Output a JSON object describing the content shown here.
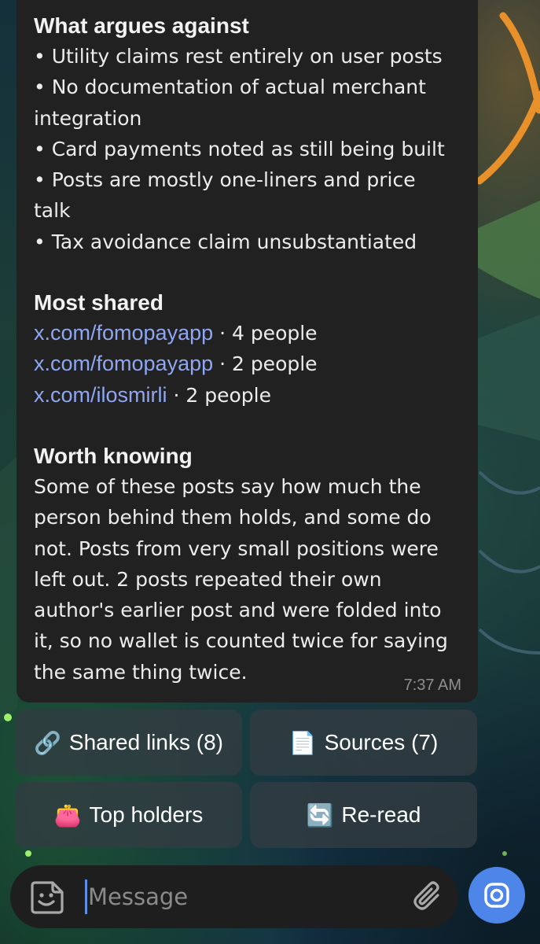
{
  "message": {
    "against": {
      "title": "What argues against",
      "lines": [
        "• Utility claims rest entirely on user posts",
        "• No documentation of actual merchant",
        "integration",
        "• Card payments noted as still being built",
        "• Posts are mostly one-liners and price",
        "talk",
        "• Tax avoidance claim unsubstantiated"
      ]
    },
    "most_shared": {
      "title": "Most shared",
      "links": [
        {
          "url": "x.com/fomopayapp",
          "count": " · 4 people"
        },
        {
          "url": "x.com/fomopayapp",
          "count": " · 2 people"
        },
        {
          "url": "x.com/ilosmirli",
          "count": " · 2 people"
        }
      ]
    },
    "worth_knowing": {
      "title": "Worth knowing",
      "lines": [
        "Some of these posts say how much the",
        "person behind them holds, and some do",
        "not. Posts from very small positions were",
        "left out. 2 posts repeated their own",
        "author's earlier post and were folded into",
        "it, so no wallet is counted twice for saying",
        "the same thing twice."
      ]
    },
    "time": "7:37 AM"
  },
  "keyboard": {
    "shared_links": {
      "icon": "🔗",
      "label": "Shared links (8)"
    },
    "sources": {
      "icon": "📄",
      "label": "Sources (7)"
    },
    "top_holders": {
      "icon": "👛",
      "label": "Top holders"
    },
    "reread": {
      "icon": "🔄",
      "label": "Re-read"
    }
  },
  "composer": {
    "placeholder": "Message"
  },
  "colors": {
    "bubble": "#212121",
    "link": "#8fa7f2",
    "accent": "#4d86e8"
  },
  "icons": [
    "sticker-icon",
    "paperclip-icon",
    "camera-icon"
  ]
}
